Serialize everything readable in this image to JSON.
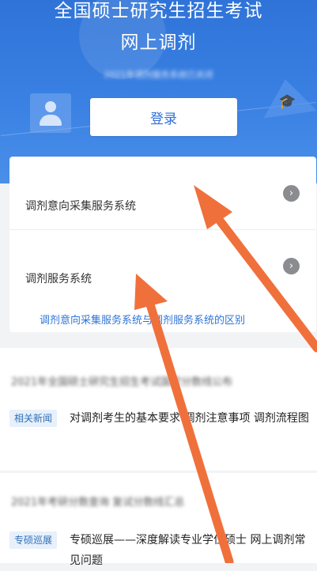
{
  "header": {
    "title_line1": "全国硕士研究生招生考试",
    "title_line2": "网上调剂",
    "subtitle": "2021年调剂服务系统已关闭",
    "login_label": "登录"
  },
  "systems": {
    "items": [
      {
        "label": "调剂意向采集服务系统",
        "icon": "chevron-right-icon"
      },
      {
        "label": "调剂服务系统",
        "icon": "chevron-right-icon"
      }
    ],
    "difference_link": "调剂意向采集服务系统与调剂服务系统的区别"
  },
  "news": [
    {
      "headline": "2021年全国硕士研究生招生考试国家分数线公布",
      "tag": "相关新闻",
      "text": "对调剂考生的基本要求 调剂注意事项 调剂流程图"
    },
    {
      "headline": "2021年考研分数查询 复试分数线汇总",
      "tag": "专硕巡展",
      "text": "专硕巡展——深度解读专业学位硕士 网上调剂常见问题"
    }
  ],
  "colors": {
    "hero_blue": "#2f73d8",
    "link_blue": "#2f75d6",
    "annotation_arrow": "#f0703c"
  }
}
